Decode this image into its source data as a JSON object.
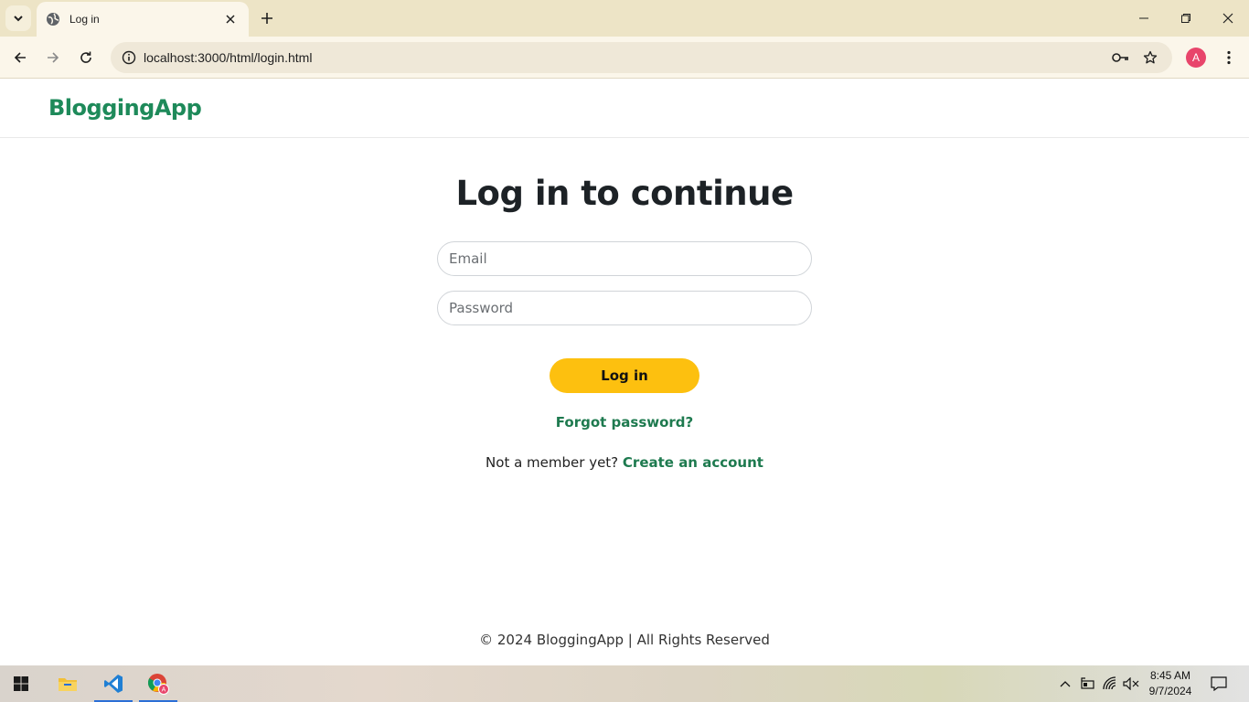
{
  "browser": {
    "tab_title": "Log in",
    "url": "localhost:3000/html/login.html",
    "profile_initial": "A"
  },
  "site": {
    "brand": "BloggingApp"
  },
  "login": {
    "heading": "Log in to continue",
    "email_placeholder": "Email",
    "password_placeholder": "Password",
    "submit_label": "Log in",
    "forgot_label": "Forgot password?",
    "signup_prompt": "Not a member yet?",
    "signup_link": "Create an account"
  },
  "footer": {
    "text": "© 2024 BloggingApp | All Rights Reserved"
  },
  "taskbar": {
    "time": "8:45 AM",
    "date": "9/7/2024"
  },
  "colors": {
    "brand_green": "#1e8a5a",
    "button_yellow": "#fdc00f",
    "chrome_frame": "#ede4c6"
  }
}
